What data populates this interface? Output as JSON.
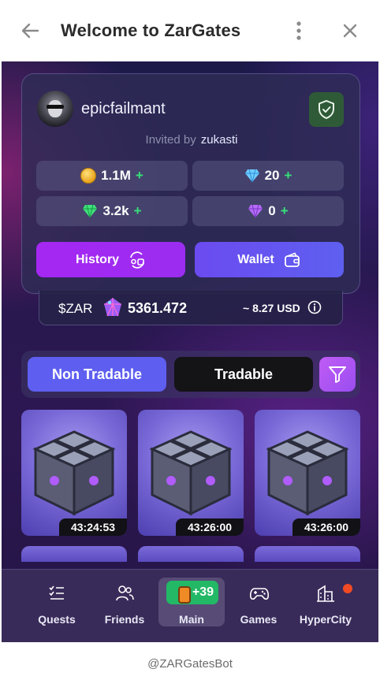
{
  "titlebar": {
    "title": "Welcome to ZarGates"
  },
  "profile": {
    "username": "epicfailmant",
    "invited_label": "Invited by",
    "invited_by": "zukasti",
    "stats": [
      {
        "icon": "gold-coin-icon",
        "value": "1.1M",
        "plus": "+"
      },
      {
        "icon": "blue-diamond-icon",
        "value": "20",
        "plus": "+"
      },
      {
        "icon": "green-gem-icon",
        "value": "3.2k",
        "plus": "+"
      },
      {
        "icon": "purple-gem-icon",
        "value": "0",
        "plus": "+"
      }
    ],
    "history_label": "History",
    "wallet_label": "Wallet"
  },
  "balance": {
    "token": "$ZAR",
    "amount": "5361.472",
    "usd": "~ 8.27 USD"
  },
  "tabs": {
    "non_tradable": "Non Tradable",
    "tradable": "Tradable",
    "active": "Non Tradable"
  },
  "items": [
    {
      "timer": "43:24:53"
    },
    {
      "timer": "43:26:00"
    },
    {
      "timer": "43:26:00"
    }
  ],
  "nav": {
    "items": [
      {
        "label": "Quests",
        "icon": "quests-icon"
      },
      {
        "label": "Friends",
        "icon": "friends-icon"
      },
      {
        "label": "Main",
        "icon": "main-character-icon",
        "badge": "+39"
      },
      {
        "label": "Games",
        "icon": "gamepad-icon"
      },
      {
        "label": "HyperCity",
        "icon": "building-icon"
      }
    ],
    "active": "Main"
  },
  "footer": {
    "bot": "@ZARGatesBot"
  },
  "colors": {
    "accent": "#5e5ff0",
    "history": "#a527f2",
    "plus": "#37e07a",
    "badge": "#22b866",
    "shield": "#2f5a37"
  }
}
